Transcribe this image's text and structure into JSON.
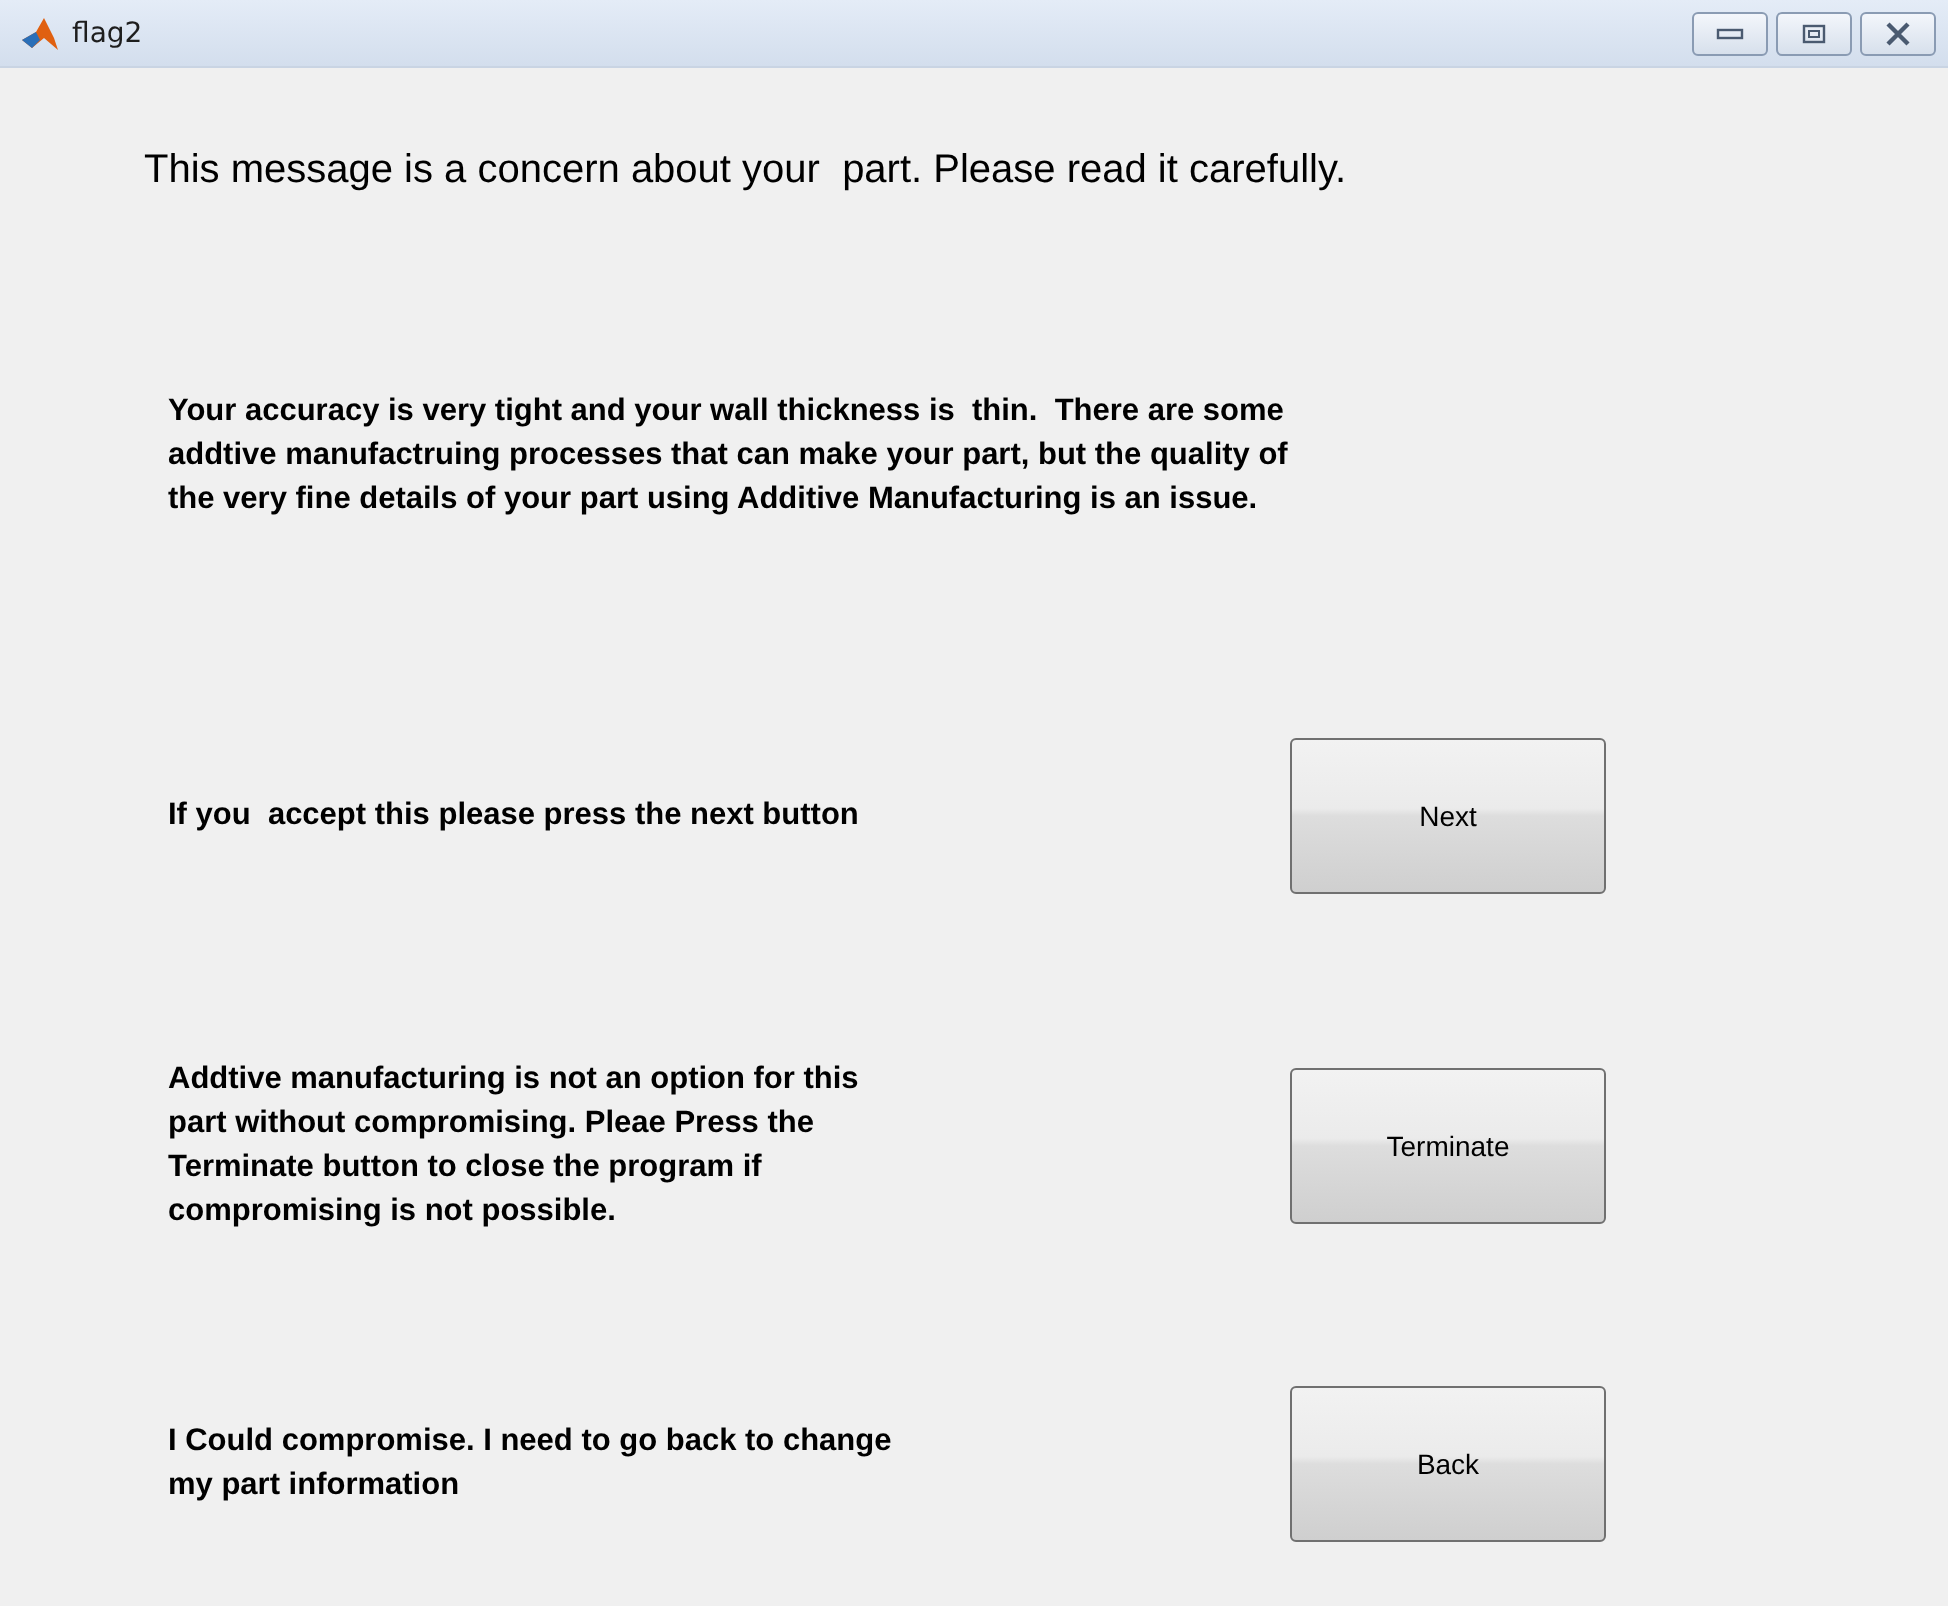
{
  "window": {
    "title": "flag2"
  },
  "heading": "This message is a concern about your  part. Please read it carefully.",
  "message": "Your accuracy is very tight and your wall thickness is  thin.  There are some\naddtive manufactruing processes that can make your part, but the quality of\nthe very fine details of your part using Additive Manufacturing is an issue.",
  "options": [
    {
      "text": "If you  accept this please press the next button",
      "button": "Next"
    },
    {
      "text": "Addtive manufacturing is not an option for this\npart without compromising. Pleae Press the\nTerminate button to close the program if\ncompromising is not possible.",
      "button": "Terminate"
    },
    {
      "text": "I Could compromise. I need to go back to change\nmy part information",
      "button": "Back"
    }
  ]
}
